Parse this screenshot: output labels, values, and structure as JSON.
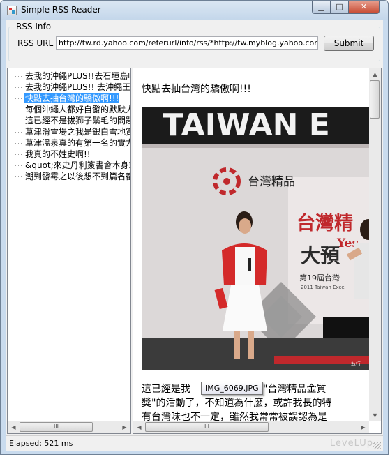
{
  "window": {
    "title": "Simple RSS Reader",
    "controls": {
      "minimize": "▁",
      "maximize": "□",
      "close": "✕"
    }
  },
  "rss_info": {
    "group_label": "RSS Info",
    "url_label": "RSS URL",
    "url_value": "http://tw.rd.yahoo.com/referurl/info/rss/*http://tw.myblog.yahoo.com/arsablue",
    "submit_label": "Submit"
  },
  "feed": {
    "items": [
      {
        "label": "去我的沖繩PLUS!!去石垣島吃"
      },
      {
        "label": "去我的沖繩PLUS!! 去沖繩王國"
      },
      {
        "label": "快點去抽台灣的驕傲啊!!!",
        "selected": true
      },
      {
        "label": "每個沖繩人都好自發的默默人"
      },
      {
        "label": "這已經不是拔獅子鬃毛的問題"
      },
      {
        "label": "草津滑雪場之我是銀白雪地賞"
      },
      {
        "label": "草津溫泉真的有第一名的實力"
      },
      {
        "label": "我真的不姓史啊!!"
      },
      {
        "label": "&quot;來史丹利簽書會本身就"
      },
      {
        "label": "潮到發霉之以後想不到篇名都"
      }
    ]
  },
  "post": {
    "title": "快點去抽台灣的驕傲啊!!!",
    "tooltip": "IMG_6069.JPG",
    "photo": {
      "banner_text": "TAIWAN E",
      "brand_text": "台灣精品",
      "red_text": "台灣精",
      "sub_text": "Yes",
      "big_text": "大預",
      "number_text": "第19屆台灣",
      "year_text": "2011 Taiwan Excel",
      "small_text": "執行"
    },
    "body_line1_left": "這已經是我",
    "body_line1_right": "參加\"台灣精品金質",
    "body_line2": "獎\"的活動了，不知道為什麼，或許我長的特",
    "body_line3": "有台灣味也不一定，雖然我常常被誤認為是"
  },
  "scrollbars": {
    "up": "▲",
    "down": "▼",
    "left": "◀",
    "right": "▶",
    "grip": "III"
  },
  "status": {
    "elapsed": "Elapsed: 521 ms",
    "watermark": "LeveLUp"
  }
}
